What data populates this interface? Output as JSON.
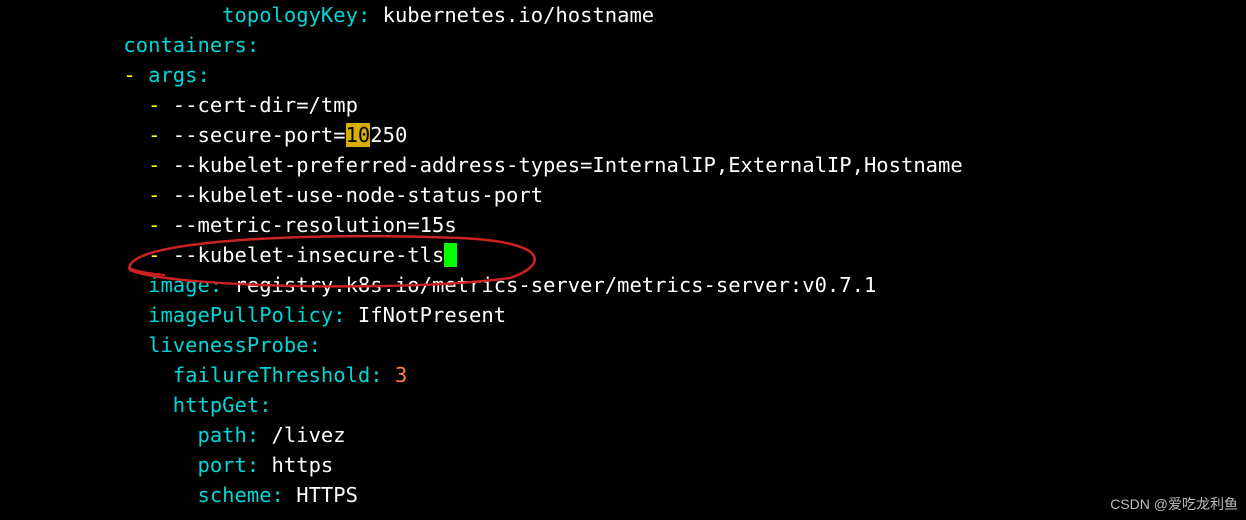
{
  "indent": {
    "l2": "          ",
    "l3": "              ",
    "l4": "        ",
    "b3": "            ",
    "b4": "                "
  },
  "yaml": {
    "topologyKey": {
      "key": "topologyKey",
      "value": " kubernetes.io/hostname"
    },
    "containers": {
      "key": "containers"
    },
    "args": {
      "dash": "- ",
      "key": "args"
    },
    "argItems": {
      "dash": "- ",
      "certDir": "--cert-dir=/tmp",
      "securePortPrefix": "--secure-port=",
      "securePortHl": "10",
      "securePortRest": "250",
      "preferred": "--kubelet-preferred-address-types=InternalIP,ExternalIP,Hostname",
      "nodeStatus": "--kubelet-use-node-status-port",
      "metricRes": "--metric-resolution=15s",
      "insecure": "--kubelet-insecure-tls"
    },
    "image": {
      "key": "image",
      "value": " registry.k8s.io/metrics-server/metrics-server:v0.7.1"
    },
    "imagePullPolicy": {
      "key": "imagePullPolicy",
      "value": " IfNotPresent"
    },
    "livenessProbe": {
      "key": "livenessProbe"
    },
    "failureThreshold": {
      "key": "failureThreshold",
      "value": "3"
    },
    "httpGet": {
      "key": "httpGet"
    },
    "path": {
      "key": "path",
      "value": " /livez"
    },
    "port": {
      "key": "port",
      "value": " https"
    },
    "scheme": {
      "key": "scheme",
      "value": " HTTPS"
    }
  },
  "colon": ":",
  "watermark": "CSDN @爱吃龙利鱼",
  "cursor": " "
}
